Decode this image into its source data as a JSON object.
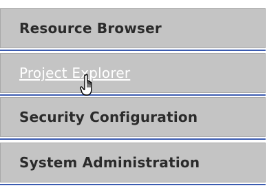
{
  "nav": {
    "items": [
      {
        "label": "Resource Browser"
      },
      {
        "label": "Project Explorer"
      },
      {
        "label": "Security Configuration"
      },
      {
        "label": "System Administration"
      }
    ]
  },
  "cursor": {
    "icon": "hand-pointer-icon"
  },
  "colors": {
    "item_background": "#c4c4c4",
    "separator": "#3b5bb0",
    "text": "#2b2b2b",
    "hover_text": "#ffffff"
  }
}
